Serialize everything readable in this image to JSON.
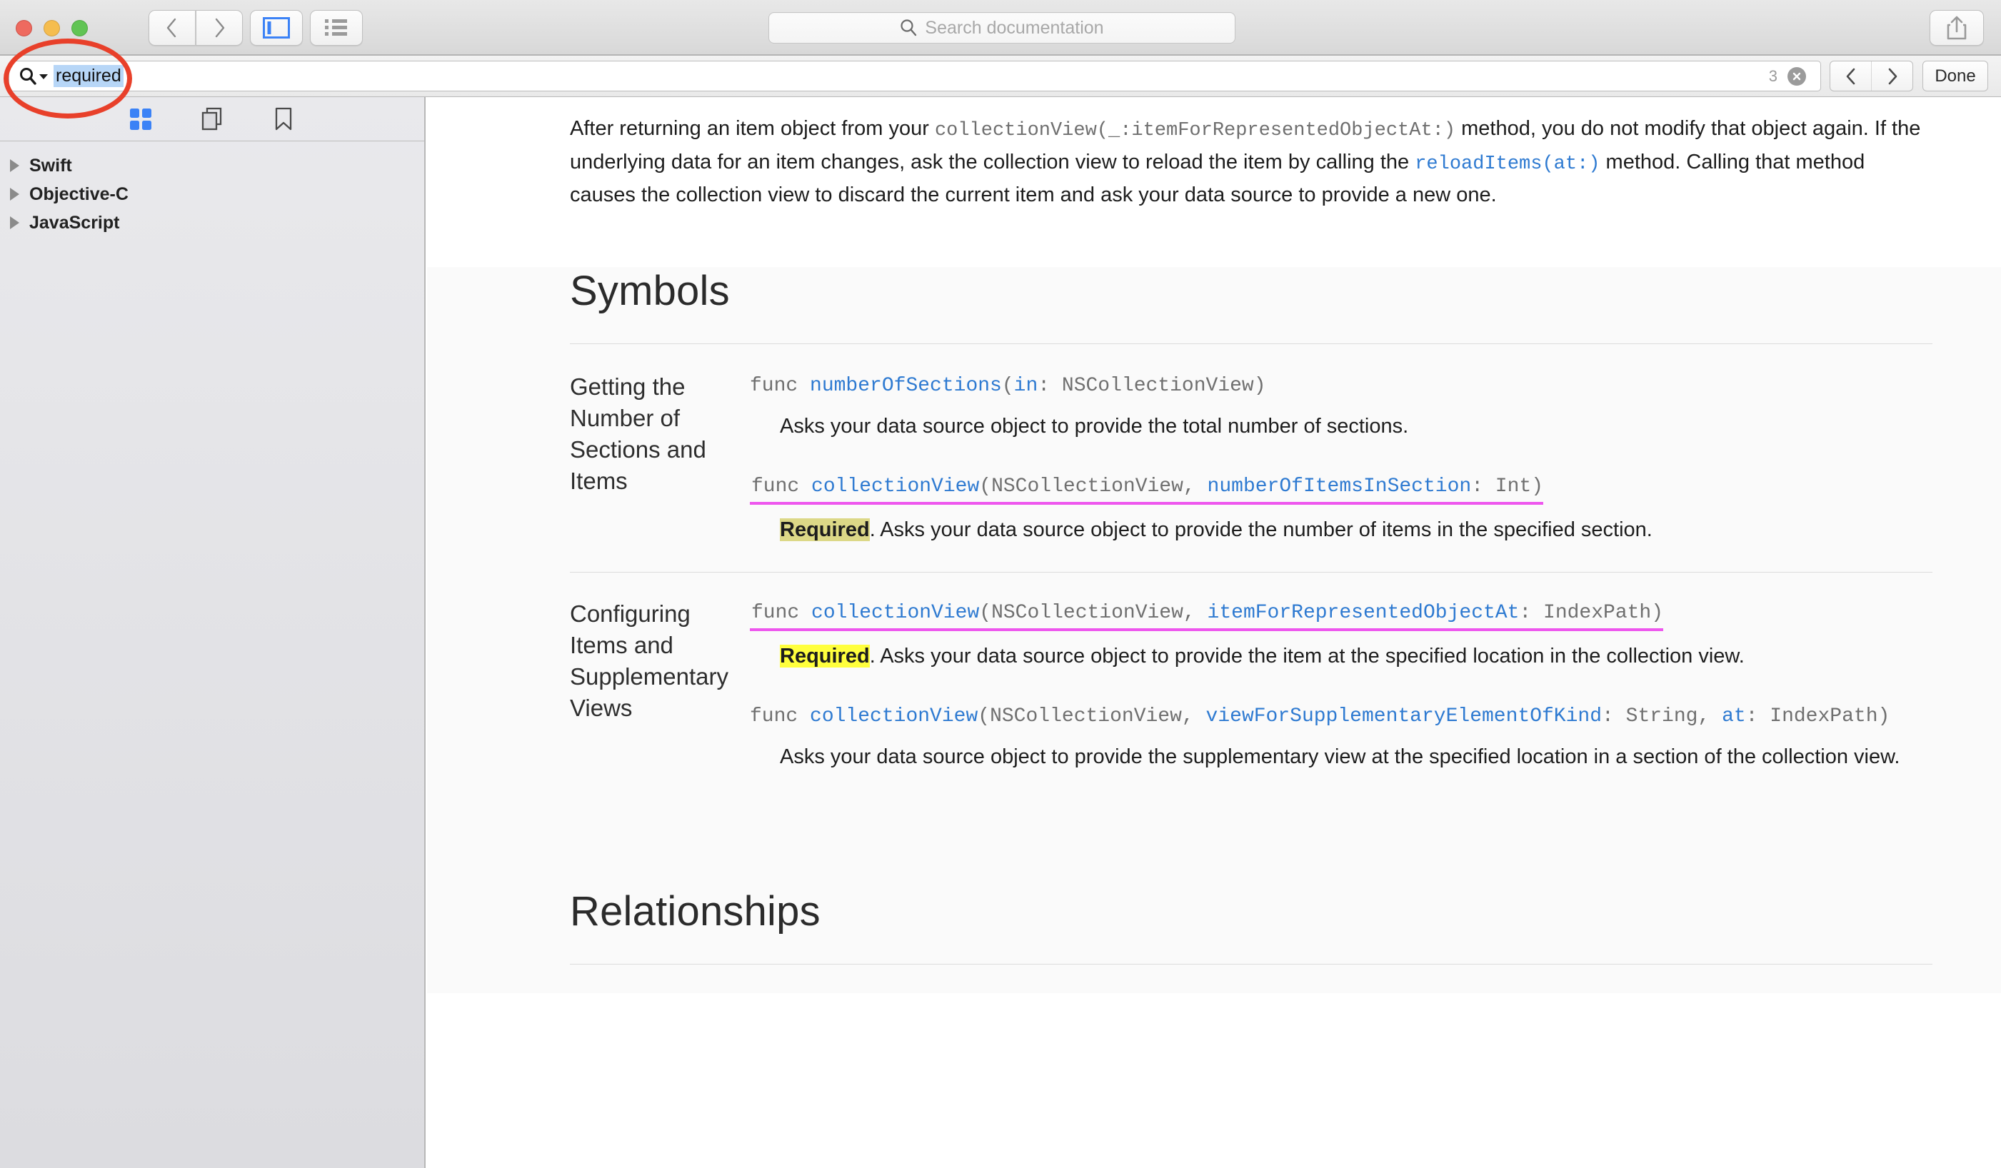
{
  "window": {
    "traffic_lights": [
      "close",
      "minimize",
      "zoom"
    ]
  },
  "toolbar": {
    "back_label": "Back",
    "forward_label": "Forward",
    "sidebar_toggle_label": "Toggle Sidebar",
    "list_view_label": "List View",
    "share_label": "Share",
    "search": {
      "placeholder": "Search documentation",
      "value": ""
    },
    "accent_color": "#2e7ad1"
  },
  "find_bar": {
    "icon": "search-icon",
    "query": "required",
    "match_count": "3",
    "clear_label": "Clear",
    "previous_label": "Previous match",
    "next_label": "Next match",
    "done_label": "Done",
    "selection_color": "#b7d6f7"
  },
  "annotation": {
    "shape": "ellipse",
    "color": "#e8402a",
    "target": "find-field"
  },
  "sidebar": {
    "toolbar_icons": [
      {
        "name": "grid-icon",
        "active": true,
        "color": "#3b82f6"
      },
      {
        "name": "pages-icon",
        "active": false,
        "color": "#555555"
      },
      {
        "name": "bookmark-icon",
        "active": false,
        "color": "#555555"
      }
    ],
    "items": [
      {
        "label": "Swift",
        "expanded": false
      },
      {
        "label": "Objective-C",
        "expanded": false
      },
      {
        "label": "JavaScript",
        "expanded": false
      }
    ]
  },
  "content": {
    "intro": {
      "part1": "After returning an item object from your ",
      "code1": "collectionView(_:itemForRepresentedObjectAt:)",
      "part2": " method, you do not modify that object again. If the underlying data for an item changes, ask the collection view to reload the item by calling the ",
      "code2": "reloadItems(at:)",
      "part3": " method. Calling that method causes the collection view to discard the current item and ask your data source to provide a new one."
    },
    "symbols_heading": "Symbols",
    "relationships_heading": "Relationships",
    "groups": [
      {
        "title": "Getting the Number of Sections and Items",
        "entries": [
          {
            "signature_parts": [
              {
                "text": "func ",
                "kind": "keyword"
              },
              {
                "text": "numberOfSections",
                "kind": "id"
              },
              {
                "text": "(",
                "kind": "plain"
              },
              {
                "text": "in",
                "kind": "id"
              },
              {
                "text": ": NSCollectionView)",
                "kind": "plain"
              }
            ],
            "underlined": false,
            "required_label": "",
            "required_state": "none",
            "description": "Asks your data source object to provide the total number of sections."
          },
          {
            "signature_parts": [
              {
                "text": "func ",
                "kind": "keyword"
              },
              {
                "text": "collectionView",
                "kind": "id"
              },
              {
                "text": "(NSCollectionView, ",
                "kind": "plain"
              },
              {
                "text": "numberOfItemsInSection",
                "kind": "id"
              },
              {
                "text": ": Int)",
                "kind": "plain"
              }
            ],
            "underlined": true,
            "required_label": "Required",
            "required_state": "inactive",
            "description": ". Asks your data source object to provide the number of items in the specified section."
          }
        ]
      },
      {
        "title": "Configuring Items and Supplementary Views",
        "entries": [
          {
            "signature_parts": [
              {
                "text": "func ",
                "kind": "keyword"
              },
              {
                "text": "collectionView",
                "kind": "id"
              },
              {
                "text": "(NSCollectionView, ",
                "kind": "plain"
              },
              {
                "text": "itemForRepresentedObjectAt",
                "kind": "id"
              },
              {
                "text": ": IndexPath)",
                "kind": "plain"
              }
            ],
            "underlined": true,
            "required_label": "Required",
            "required_state": "active",
            "description": ". Asks your data source object to provide the item at the specified location in the collection view."
          },
          {
            "signature_parts": [
              {
                "text": "func ",
                "kind": "keyword"
              },
              {
                "text": "collectionView",
                "kind": "id"
              },
              {
                "text": "(NSCollectionView, ",
                "kind": "plain"
              },
              {
                "text": "viewForSupplementaryElementOfKind",
                "kind": "id"
              },
              {
                "text": ": String, ",
                "kind": "plain"
              },
              {
                "text": "at",
                "kind": "id"
              },
              {
                "text": ": IndexPath)",
                "kind": "plain"
              }
            ],
            "underlined": false,
            "required_label": "",
            "required_state": "none",
            "description": "Asks your data source object to provide the supplementary view at the specified location in a section of the collection view."
          }
        ]
      }
    ],
    "highlight_colors": {
      "active": "#ffff3d",
      "inactive": "#dcd887",
      "signature_underline": "#ee56ee"
    }
  }
}
